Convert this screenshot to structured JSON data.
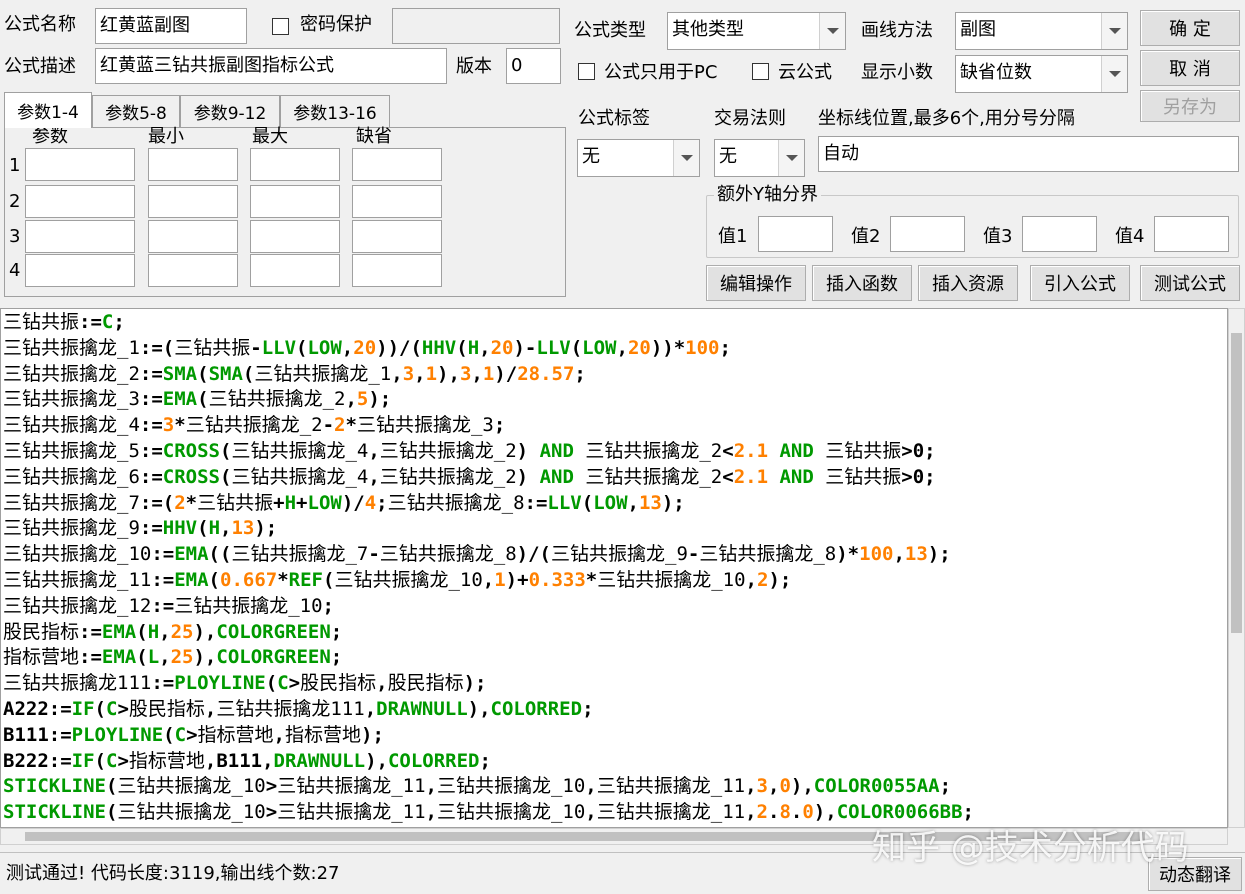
{
  "header": {
    "name_label": "公式名称",
    "name_value": "红黄蓝副图",
    "password_label": "密码保护",
    "desc_label": "公式描述",
    "desc_value": "红黄蓝三钻共振副图指标公式",
    "version_label": "版本",
    "version_value": "0",
    "type_label": "公式类型",
    "type_value": "其他类型",
    "draw_label": "画线方法",
    "draw_value": "副图",
    "pc_only_label": "公式只用于PC",
    "cloud_label": "云公式",
    "decimals_label": "显示小数",
    "decimals_value": "缺省位数",
    "ok_button": "确 定",
    "cancel_button": "取 消",
    "saveas_button": "另存为"
  },
  "tabs": [
    "参数1-4",
    "参数5-8",
    "参数9-12",
    "参数13-16"
  ],
  "params": {
    "headers": [
      "参数",
      "最小",
      "最大",
      "缺省"
    ],
    "rows": [
      "1",
      "2",
      "3",
      "4"
    ]
  },
  "tags": {
    "tag_label": "公式标签",
    "tag_value": "无",
    "rule_label": "交易法则",
    "rule_value": "无",
    "coord_label": "坐标线位置,最多6个,用分号分隔",
    "coord_value": "自动"
  },
  "yaxis": {
    "title": "额外Y轴分界",
    "labels": [
      "值1",
      "值2",
      "值3",
      "值4"
    ]
  },
  "actions": [
    "编辑操作",
    "插入函数",
    "插入资源",
    "引入公式",
    "测试公式"
  ],
  "code_lines": [
    [
      [
        "d",
        "三钻共振"
      ],
      [
        "o",
        ":="
      ],
      [
        "f",
        "C"
      ],
      [
        "o",
        ";"
      ]
    ],
    [
      [
        "d",
        "三钻共振擒龙_1"
      ],
      [
        "o",
        ":=("
      ],
      [
        "d",
        "三钻共振"
      ],
      [
        "o",
        "-"
      ],
      [
        "f",
        "LLV"
      ],
      [
        "o",
        "("
      ],
      [
        "f",
        "LOW"
      ],
      [
        "o",
        ","
      ],
      [
        "n",
        "20"
      ],
      [
        "o",
        "))/("
      ],
      [
        "f",
        "HHV"
      ],
      [
        "o",
        "("
      ],
      [
        "f",
        "H"
      ],
      [
        "o",
        ","
      ],
      [
        "n",
        "20"
      ],
      [
        "o",
        ")-"
      ],
      [
        "f",
        "LLV"
      ],
      [
        "o",
        "("
      ],
      [
        "f",
        "LOW"
      ],
      [
        "o",
        ","
      ],
      [
        "n",
        "20"
      ],
      [
        "o",
        "))*"
      ],
      [
        "n",
        "100"
      ],
      [
        "o",
        ";"
      ]
    ],
    [
      [
        "d",
        "三钻共振擒龙_2"
      ],
      [
        "o",
        ":="
      ],
      [
        "f",
        "SMA"
      ],
      [
        "o",
        "("
      ],
      [
        "f",
        "SMA"
      ],
      [
        "o",
        "("
      ],
      [
        "d",
        "三钻共振擒龙_1"
      ],
      [
        "o",
        ","
      ],
      [
        "n",
        "3"
      ],
      [
        "o",
        ","
      ],
      [
        "n",
        "1"
      ],
      [
        "o",
        "),"
      ],
      [
        "n",
        "3"
      ],
      [
        "o",
        ","
      ],
      [
        "n",
        "1"
      ],
      [
        "o",
        ")/"
      ],
      [
        "n",
        "28.57"
      ],
      [
        "o",
        ";"
      ]
    ],
    [
      [
        "d",
        "三钻共振擒龙_3"
      ],
      [
        "o",
        ":="
      ],
      [
        "f",
        "EMA"
      ],
      [
        "o",
        "("
      ],
      [
        "d",
        "三钻共振擒龙_2"
      ],
      [
        "o",
        ","
      ],
      [
        "n",
        "5"
      ],
      [
        "o",
        ");"
      ]
    ],
    [
      [
        "d",
        "三钻共振擒龙_4"
      ],
      [
        "o",
        ":="
      ],
      [
        "n",
        "3"
      ],
      [
        "o",
        "*"
      ],
      [
        "d",
        "三钻共振擒龙_2"
      ],
      [
        "o",
        "-"
      ],
      [
        "n",
        "2"
      ],
      [
        "o",
        "*"
      ],
      [
        "d",
        "三钻共振擒龙_3"
      ],
      [
        "o",
        ";"
      ]
    ],
    [
      [
        "d",
        "三钻共振擒龙_5"
      ],
      [
        "o",
        ":="
      ],
      [
        "f",
        "CROSS"
      ],
      [
        "o",
        "("
      ],
      [
        "d",
        "三钻共振擒龙_4"
      ],
      [
        "o",
        ","
      ],
      [
        "d",
        "三钻共振擒龙_2"
      ],
      [
        "o",
        ") "
      ],
      [
        "f",
        "AND"
      ],
      [
        "o",
        " "
      ],
      [
        "d",
        "三钻共振擒龙_2"
      ],
      [
        "o",
        "<"
      ],
      [
        "n",
        "2.1"
      ],
      [
        "o",
        " "
      ],
      [
        "f",
        "AND"
      ],
      [
        "o",
        " "
      ],
      [
        "d",
        "三钻共振"
      ],
      [
        "o",
        ">0;"
      ]
    ],
    [
      [
        "d",
        "三钻共振擒龙_6"
      ],
      [
        "o",
        ":="
      ],
      [
        "f",
        "CROSS"
      ],
      [
        "o",
        "("
      ],
      [
        "d",
        "三钻共振擒龙_4"
      ],
      [
        "o",
        ","
      ],
      [
        "d",
        "三钻共振擒龙_2"
      ],
      [
        "o",
        ") "
      ],
      [
        "f",
        "AND"
      ],
      [
        "o",
        " "
      ],
      [
        "d",
        "三钻共振擒龙_2"
      ],
      [
        "o",
        "<"
      ],
      [
        "n",
        "2.1"
      ],
      [
        "o",
        " "
      ],
      [
        "f",
        "AND"
      ],
      [
        "o",
        " "
      ],
      [
        "d",
        "三钻共振"
      ],
      [
        "o",
        ">0;"
      ]
    ],
    [
      [
        "d",
        "三钻共振擒龙_7"
      ],
      [
        "o",
        ":=("
      ],
      [
        "n",
        "2"
      ],
      [
        "o",
        "*"
      ],
      [
        "d",
        "三钻共振"
      ],
      [
        "o",
        "+"
      ],
      [
        "f",
        "H"
      ],
      [
        "o",
        "+"
      ],
      [
        "f",
        "LOW"
      ],
      [
        "o",
        ")/"
      ],
      [
        "n",
        "4"
      ],
      [
        "o",
        ";"
      ],
      [
        "d",
        "三钻共振擒龙_8"
      ],
      [
        "o",
        ":="
      ],
      [
        "f",
        "LLV"
      ],
      [
        "o",
        "("
      ],
      [
        "f",
        "LOW"
      ],
      [
        "o",
        ","
      ],
      [
        "n",
        "13"
      ],
      [
        "o",
        ");"
      ]
    ],
    [
      [
        "d",
        "三钻共振擒龙_9"
      ],
      [
        "o",
        ":="
      ],
      [
        "f",
        "HHV"
      ],
      [
        "o",
        "("
      ],
      [
        "f",
        "H"
      ],
      [
        "o",
        ","
      ],
      [
        "n",
        "13"
      ],
      [
        "o",
        ");"
      ]
    ],
    [
      [
        "d",
        "三钻共振擒龙_10"
      ],
      [
        "o",
        ":="
      ],
      [
        "f",
        "EMA"
      ],
      [
        "o",
        "(("
      ],
      [
        "d",
        "三钻共振擒龙_7"
      ],
      [
        "o",
        "-"
      ],
      [
        "d",
        "三钻共振擒龙_8"
      ],
      [
        "o",
        ")/("
      ],
      [
        "d",
        "三钻共振擒龙_9"
      ],
      [
        "o",
        "-"
      ],
      [
        "d",
        "三钻共振擒龙_8"
      ],
      [
        "o",
        ")*"
      ],
      [
        "n",
        "100"
      ],
      [
        "o",
        ","
      ],
      [
        "n",
        "13"
      ],
      [
        "o",
        ");"
      ]
    ],
    [
      [
        "d",
        "三钻共振擒龙_11"
      ],
      [
        "o",
        ":="
      ],
      [
        "f",
        "EMA"
      ],
      [
        "o",
        "("
      ],
      [
        "n",
        "0.667"
      ],
      [
        "o",
        "*"
      ],
      [
        "f",
        "REF"
      ],
      [
        "o",
        "("
      ],
      [
        "d",
        "三钻共振擒龙_10"
      ],
      [
        "o",
        ","
      ],
      [
        "n",
        "1"
      ],
      [
        "o",
        ")+"
      ],
      [
        "n",
        "0.333"
      ],
      [
        "o",
        "*"
      ],
      [
        "d",
        "三钻共振擒龙_10"
      ],
      [
        "o",
        ","
      ],
      [
        "n",
        "2"
      ],
      [
        "o",
        ");"
      ]
    ],
    [
      [
        "d",
        "三钻共振擒龙_12"
      ],
      [
        "o",
        ":="
      ],
      [
        "d",
        "三钻共振擒龙_10"
      ],
      [
        "o",
        ";"
      ]
    ],
    [
      [
        "d",
        "股民指标"
      ],
      [
        "o",
        ":="
      ],
      [
        "f",
        "EMA"
      ],
      [
        "o",
        "("
      ],
      [
        "f",
        "H"
      ],
      [
        "o",
        ","
      ],
      [
        "n",
        "25"
      ],
      [
        "o",
        "),"
      ],
      [
        "f",
        "COLORGREEN"
      ],
      [
        "o",
        ";"
      ]
    ],
    [
      [
        "d",
        "指标营地"
      ],
      [
        "o",
        ":="
      ],
      [
        "f",
        "EMA"
      ],
      [
        "o",
        "("
      ],
      [
        "f",
        "L"
      ],
      [
        "o",
        ","
      ],
      [
        "n",
        "25"
      ],
      [
        "o",
        "),"
      ],
      [
        "f",
        "COLORGREEN"
      ],
      [
        "o",
        ";"
      ]
    ],
    [
      [
        "d",
        "三钻共振擒龙111"
      ],
      [
        "o",
        ":="
      ],
      [
        "f",
        "PLOYLINE"
      ],
      [
        "o",
        "("
      ],
      [
        "f",
        "C"
      ],
      [
        "o",
        ">"
      ],
      [
        "d",
        "股民指标"
      ],
      [
        "o",
        ","
      ],
      [
        "d",
        "股民指标"
      ],
      [
        "o",
        ");"
      ]
    ],
    [
      [
        "o",
        "A222:="
      ],
      [
        "f",
        "IF"
      ],
      [
        "o",
        "("
      ],
      [
        "f",
        "C"
      ],
      [
        "o",
        ">"
      ],
      [
        "d",
        "股民指标"
      ],
      [
        "o",
        ","
      ],
      [
        "d",
        "三钻共振擒龙111"
      ],
      [
        "o",
        ","
      ],
      [
        "f",
        "DRAWNULL"
      ],
      [
        "o",
        "),"
      ],
      [
        "f",
        "COLORRED"
      ],
      [
        "o",
        ";"
      ]
    ],
    [
      [
        "o",
        "B111:="
      ],
      [
        "f",
        "PLOYLINE"
      ],
      [
        "o",
        "("
      ],
      [
        "f",
        "C"
      ],
      [
        "o",
        ">"
      ],
      [
        "d",
        "指标营地"
      ],
      [
        "o",
        ","
      ],
      [
        "d",
        "指标营地"
      ],
      [
        "o",
        ");"
      ]
    ],
    [
      [
        "o",
        "B222:="
      ],
      [
        "f",
        "IF"
      ],
      [
        "o",
        "("
      ],
      [
        "f",
        "C"
      ],
      [
        "o",
        ">"
      ],
      [
        "d",
        "指标营地"
      ],
      [
        "o",
        ",B111,"
      ],
      [
        "f",
        "DRAWNULL"
      ],
      [
        "o",
        "),"
      ],
      [
        "f",
        "COLORRED"
      ],
      [
        "o",
        ";"
      ]
    ],
    [
      [
        "f",
        "STICKLINE"
      ],
      [
        "o",
        "("
      ],
      [
        "d",
        "三钻共振擒龙_10"
      ],
      [
        "o",
        ">"
      ],
      [
        "d",
        "三钻共振擒龙_11"
      ],
      [
        "o",
        ","
      ],
      [
        "d",
        "三钻共振擒龙_10"
      ],
      [
        "o",
        ","
      ],
      [
        "d",
        "三钻共振擒龙_11"
      ],
      [
        "o",
        ","
      ],
      [
        "n",
        "3"
      ],
      [
        "o",
        ","
      ],
      [
        "n",
        "0"
      ],
      [
        "o",
        "),"
      ],
      [
        "f",
        "COLOR0055AA"
      ],
      [
        "o",
        ";"
      ]
    ],
    [
      [
        "f",
        "STICKLINE"
      ],
      [
        "o",
        "("
      ],
      [
        "d",
        "三钻共振擒龙_10"
      ],
      [
        "o",
        ">"
      ],
      [
        "d",
        "三钻共振擒龙_11"
      ],
      [
        "o",
        ","
      ],
      [
        "d",
        "三钻共振擒龙_10"
      ],
      [
        "o",
        ","
      ],
      [
        "d",
        "三钻共振擒龙_11"
      ],
      [
        "o",
        ","
      ],
      [
        "n",
        "2"
      ],
      [
        "o",
        "."
      ],
      [
        "n",
        "8"
      ],
      [
        "o",
        "."
      ],
      [
        "n",
        "0"
      ],
      [
        "o",
        "),"
      ],
      [
        "f",
        "COLOR0066BB"
      ],
      [
        "o",
        ";"
      ]
    ]
  ],
  "status": {
    "message": "测试通过! 代码长度:3119,输出线个数:27",
    "translate_button": "动态翻译"
  },
  "watermark": "知乎 @技术分析代码",
  "colors": {
    "function": "#009900",
    "number": "#ff8000",
    "identifier": "#000000"
  }
}
